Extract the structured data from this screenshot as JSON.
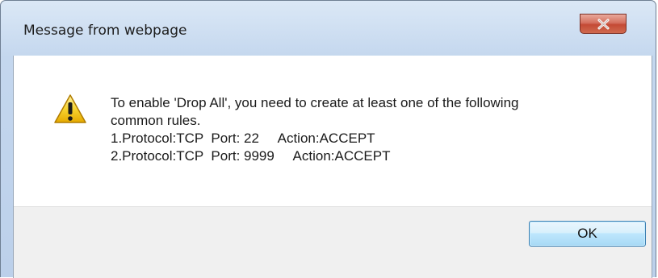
{
  "dialog": {
    "title": "Message from webpage",
    "close_icon": "close-x-icon",
    "warning_icon": "warning-triangle-icon",
    "message_lines": [
      "To enable 'Drop All', you need to create at least one of the following",
      "common rules.",
      "1.Protocol:TCP  Port: 22     Action:ACCEPT",
      "2.Protocol:TCP  Port: 9999     Action:ACCEPT"
    ],
    "ok_label": "OK"
  },
  "colors": {
    "close_button": "#c44a35",
    "titlebar": "#c4d7ee",
    "warning_fill": "#f5c400",
    "ok_border": "#3c7fb1"
  }
}
